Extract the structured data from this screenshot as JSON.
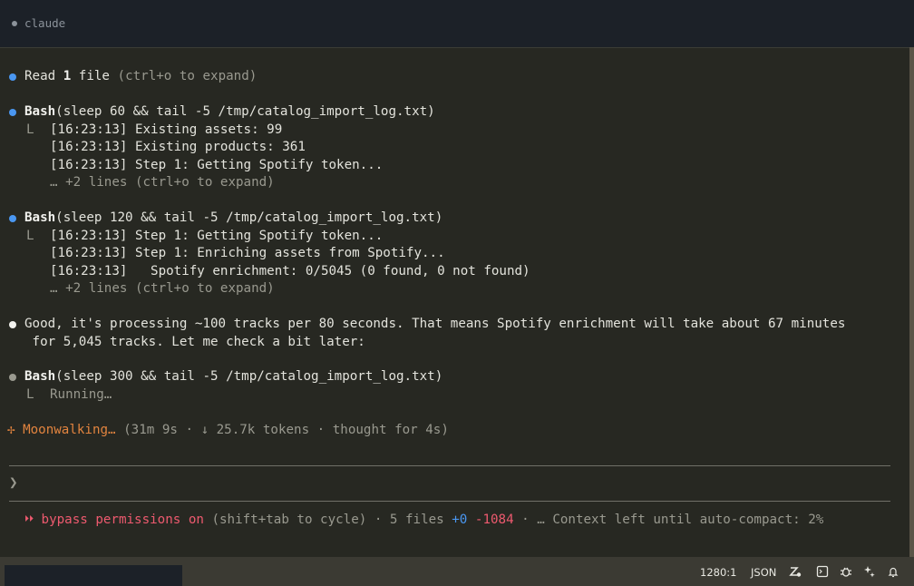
{
  "title": {
    "tab_label": "claude"
  },
  "blocks": {
    "read": {
      "prefix": "Read ",
      "count": "1",
      "suffix": " file",
      "hint": " (ctrl+o to expand)"
    },
    "bash1": {
      "tool": "Bash",
      "command": "(sleep 60 && tail -5 /tmp/catalog_import_log.txt)",
      "lines": [
        "[16:23:13] Existing assets: 99",
        "[16:23:13] Existing products: 361",
        "[16:23:13] Step 1: Getting Spotify token..."
      ],
      "more": "… +2 lines (ctrl+o to expand)"
    },
    "bash2": {
      "tool": "Bash",
      "command": "(sleep 120 && tail -5 /tmp/catalog_import_log.txt)",
      "lines": [
        "[16:23:13] Step 1: Getting Spotify token...",
        "[16:23:13] Step 1: Enriching assets from Spotify...",
        "[16:23:13]   Spotify enrichment: 0/5045 (0 found, 0 not found)"
      ],
      "more": "… +2 lines (ctrl+o to expand)"
    },
    "message": {
      "line1": "Good, it's processing ~100 tracks per 80 seconds. That means Spotify enrichment will take about 67 minutes",
      "line2": " for 5,045 tracks. Let me check a bit later:"
    },
    "bash3": {
      "tool": "Bash",
      "command": "(sleep 300 && tail -5 /tmp/catalog_import_log.txt)",
      "status": "Running…"
    },
    "spinner": {
      "glyph": "✢",
      "label": "Moonwalking…",
      "detail": " (31m 9s · ↓ 25.7k tokens · thought for 4s)"
    }
  },
  "prompt": {
    "arrow": "❯"
  },
  "footer": {
    "glyph": "⏵⏵",
    "mode": " bypass permissions on",
    "cycle_hint": " (shift+tab to cycle) · 5 files ",
    "added": "+0",
    "removed": " -1084",
    "context": " · … Context left until auto-compact: 2%"
  },
  "statusbar": {
    "cursor": "1280:1",
    "language": "JSON"
  },
  "colors": {
    "background": "#272822",
    "bullet_blue": "#4a97f1",
    "spinner_orange": "#e2843f",
    "bypass_red": "#ee5a6f"
  }
}
